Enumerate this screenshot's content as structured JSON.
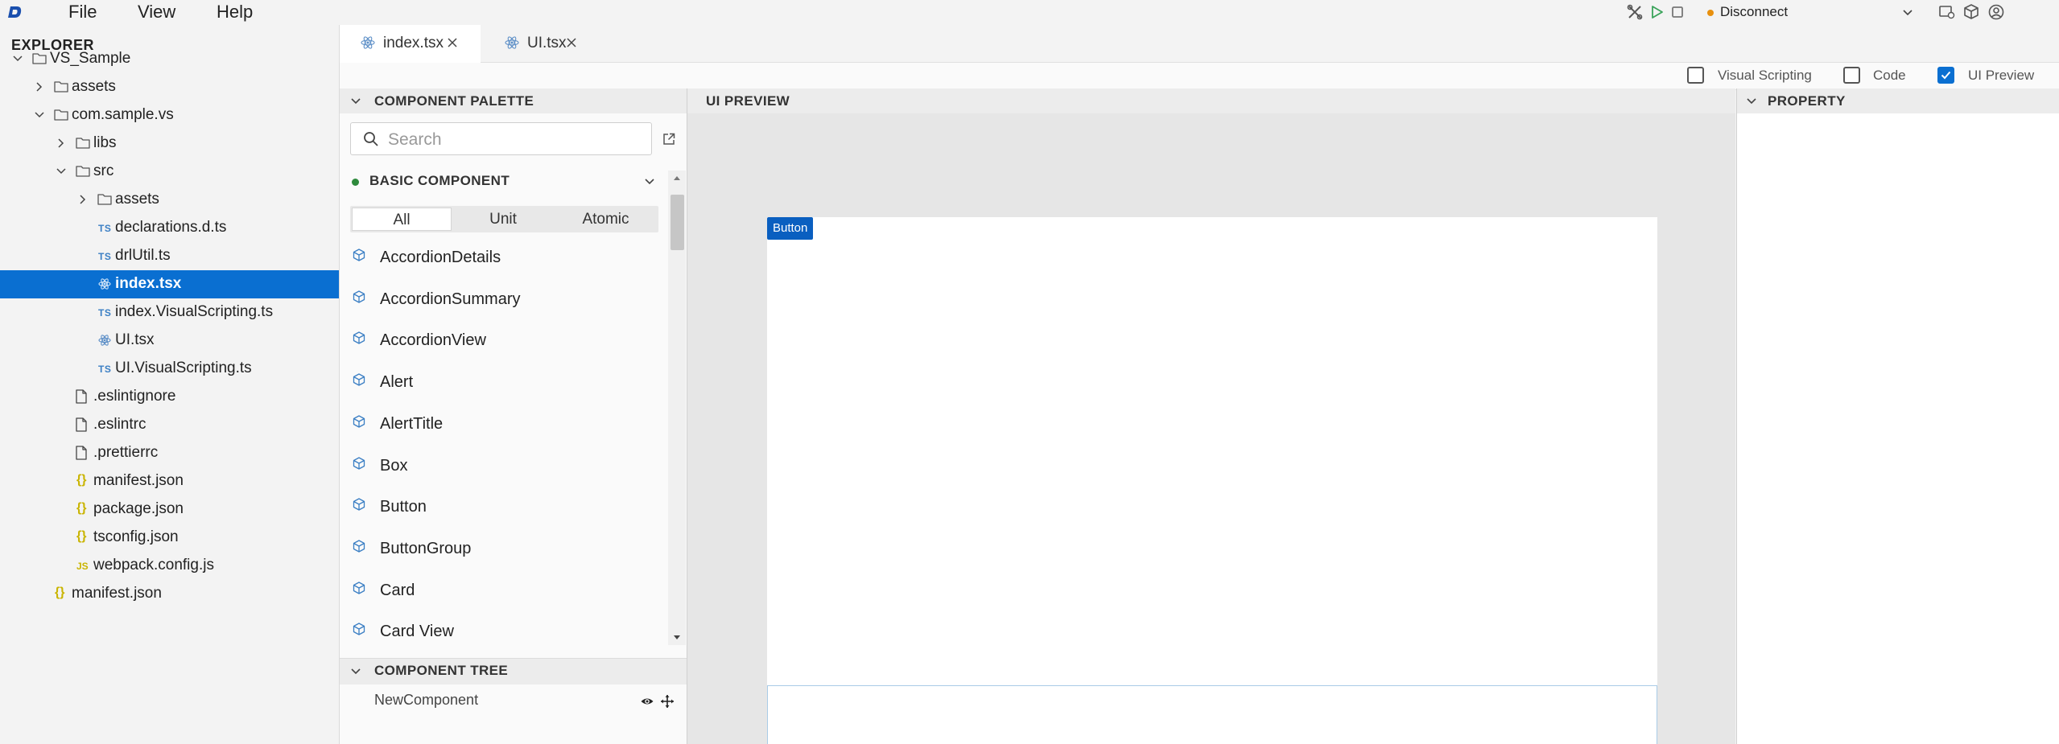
{
  "menubar": {
    "logo": "D",
    "items": [
      "File",
      "View",
      "Help"
    ],
    "toolbar_icons": [
      "tools-icon",
      "play-icon",
      "stop-icon"
    ],
    "connection": {
      "label": "Disconnect",
      "status_color": "#e8900e"
    },
    "right_icons": [
      "device-icon",
      "package-icon",
      "account-icon"
    ]
  },
  "explorer": {
    "title": "EXPLORER",
    "tree": [
      {
        "label": "VS_Sample",
        "type": "folder",
        "expanded": true,
        "depth": 0
      },
      {
        "label": "assets",
        "type": "folder",
        "expanded": false,
        "depth": 1
      },
      {
        "label": "com.sample.vs",
        "type": "folder",
        "expanded": true,
        "depth": 1
      },
      {
        "label": "libs",
        "type": "folder",
        "expanded": false,
        "depth": 2
      },
      {
        "label": "src",
        "type": "folder",
        "expanded": true,
        "depth": 2
      },
      {
        "label": "assets",
        "type": "folder",
        "expanded": false,
        "depth": 3
      },
      {
        "label": "declarations.d.ts",
        "type": "ts",
        "depth": 3
      },
      {
        "label": "drlUtil.ts",
        "type": "ts",
        "depth": 3
      },
      {
        "label": "index.tsx",
        "type": "react",
        "depth": 3,
        "selected": true
      },
      {
        "label": "index.VisualScripting.ts",
        "type": "ts",
        "depth": 3
      },
      {
        "label": "UI.tsx",
        "type": "react",
        "depth": 3
      },
      {
        "label": "UI.VisualScripting.ts",
        "type": "ts",
        "depth": 3
      },
      {
        "label": ".eslintignore",
        "type": "file",
        "depth": 2
      },
      {
        "label": ".eslintrc",
        "type": "file",
        "depth": 2
      },
      {
        "label": ".prettierrc",
        "type": "file",
        "depth": 2
      },
      {
        "label": "manifest.json",
        "type": "json",
        "depth": 2
      },
      {
        "label": "package.json",
        "type": "json",
        "depth": 2
      },
      {
        "label": "tsconfig.json",
        "type": "json",
        "depth": 2
      },
      {
        "label": "webpack.config.js",
        "type": "js",
        "depth": 2
      },
      {
        "label": "manifest.json",
        "type": "json",
        "depth": 1
      }
    ]
  },
  "tabs": [
    {
      "label": "index.tsx",
      "active": true
    },
    {
      "label": "UI.tsx",
      "active": false
    }
  ],
  "modes": [
    {
      "label": "Visual Scripting",
      "checked": false
    },
    {
      "label": "Code",
      "checked": false
    },
    {
      "label": "UI Preview",
      "checked": true
    }
  ],
  "palette": {
    "title": "COMPONENT PALETTE",
    "search_placeholder": "Search",
    "section": "BASIC COMPONENT",
    "filters": [
      "All",
      "Unit",
      "Atomic"
    ],
    "components": [
      "AccordionDetails",
      "AccordionSummary",
      "AccordionView",
      "Alert",
      "AlertTitle",
      "Box",
      "Button",
      "ButtonGroup",
      "Card",
      "Card View"
    ]
  },
  "component_tree": {
    "title": "COMPONENT TREE",
    "items": [
      "NewComponent"
    ]
  },
  "preview": {
    "title": "UI PREVIEW",
    "selected_tag": "Button"
  },
  "property": {
    "title": "PROPERTY"
  },
  "colors": {
    "accent": "#0a6fd1",
    "selection_tag": "#0a5fc0",
    "ts_badge": "#3b7fc4",
    "json_badge": "#c9b400",
    "section_dot": "#2e8a3c",
    "connection_dot": "#e8900e"
  }
}
